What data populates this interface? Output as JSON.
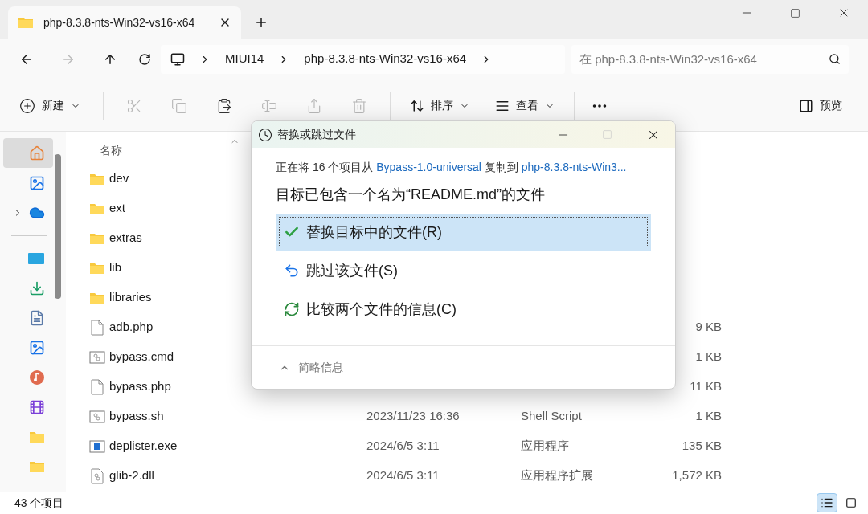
{
  "tab": {
    "title": "php-8.3.8-nts-Win32-vs16-x64"
  },
  "breadcrumb": [
    "MIUI14",
    "php-8.3.8-nts-Win32-vs16-x64"
  ],
  "search": {
    "placeholder": "在 php-8.3.8-nts-Win32-vs16-x64"
  },
  "toolbar": {
    "new": "新建",
    "actions": [
      {
        "kind": "cut",
        "disabled": true
      },
      {
        "kind": "copy",
        "disabled": true
      },
      {
        "kind": "paste",
        "disabled": false
      },
      {
        "kind": "rename",
        "disabled": true
      },
      {
        "kind": "share",
        "disabled": true
      },
      {
        "kind": "delete",
        "disabled": true
      }
    ],
    "sort": "排序",
    "view": "查看",
    "preview": "预览"
  },
  "sidebar": {
    "items": [
      {
        "kind": "home",
        "selected": true
      },
      {
        "kind": "gallery",
        "selected": false
      },
      {
        "kind": "onedrive",
        "selected": false
      },
      {
        "kind": "divider"
      },
      {
        "kind": "desktop",
        "selected": false
      },
      {
        "kind": "downloads",
        "selected": false
      },
      {
        "kind": "documents",
        "selected": false
      },
      {
        "kind": "pictures",
        "selected": false
      },
      {
        "kind": "music",
        "selected": false
      },
      {
        "kind": "videos",
        "selected": false
      },
      {
        "kind": "folder",
        "selected": false
      },
      {
        "kind": "folder",
        "selected": false
      }
    ]
  },
  "table": {
    "columns": [
      "名称"
    ],
    "rows": [
      {
        "kind": "folder",
        "name": "dev"
      },
      {
        "kind": "folder",
        "name": "ext"
      },
      {
        "kind": "folder",
        "name": "extras"
      },
      {
        "kind": "folder",
        "name": "lib"
      },
      {
        "kind": "folder",
        "name": "libraries"
      },
      {
        "kind": "file",
        "name": "adb.php",
        "size": "9 KB"
      },
      {
        "kind": "script",
        "name": "bypass.cmd",
        "size": "1 KB"
      },
      {
        "kind": "file",
        "name": "bypass.php",
        "size": "11 KB"
      },
      {
        "kind": "script",
        "name": "bypass.sh",
        "date": "2023/11/23 16:36",
        "type": "Shell Script",
        "size": "1 KB"
      },
      {
        "kind": "exe",
        "name": "deplister.exe",
        "date": "2024/6/5 3:11",
        "type": "应用程序",
        "size": "135 KB"
      },
      {
        "kind": "dll",
        "name": "glib-2.dll",
        "date": "2024/6/5 3:11",
        "type": "应用程序扩展",
        "size": "1,572 KB"
      }
    ]
  },
  "status_bar": {
    "count": "43 个项目",
    "views": [
      {
        "kind": "details",
        "selected": true
      },
      {
        "kind": "tiles",
        "selected": false
      }
    ]
  },
  "dialog": {
    "title": "替换或跳过文件",
    "message": {
      "prefix": "正在将 16 个项目从 ",
      "source": "Bypass-1.0-universal",
      "middle": " 复制到 ",
      "target": "php-8.3.8-nts-Win3..."
    },
    "heading": "目标已包含一个名为“README.md”的文件",
    "options": [
      {
        "kind": "replace",
        "label": "替换目标中的文件(R)",
        "selected": true
      },
      {
        "kind": "skip",
        "label": "跳过该文件(S)",
        "selected": false
      },
      {
        "kind": "compare",
        "label": "比较两个文件的信息(C)",
        "selected": false
      }
    ],
    "details_toggle": "简略信息"
  }
}
